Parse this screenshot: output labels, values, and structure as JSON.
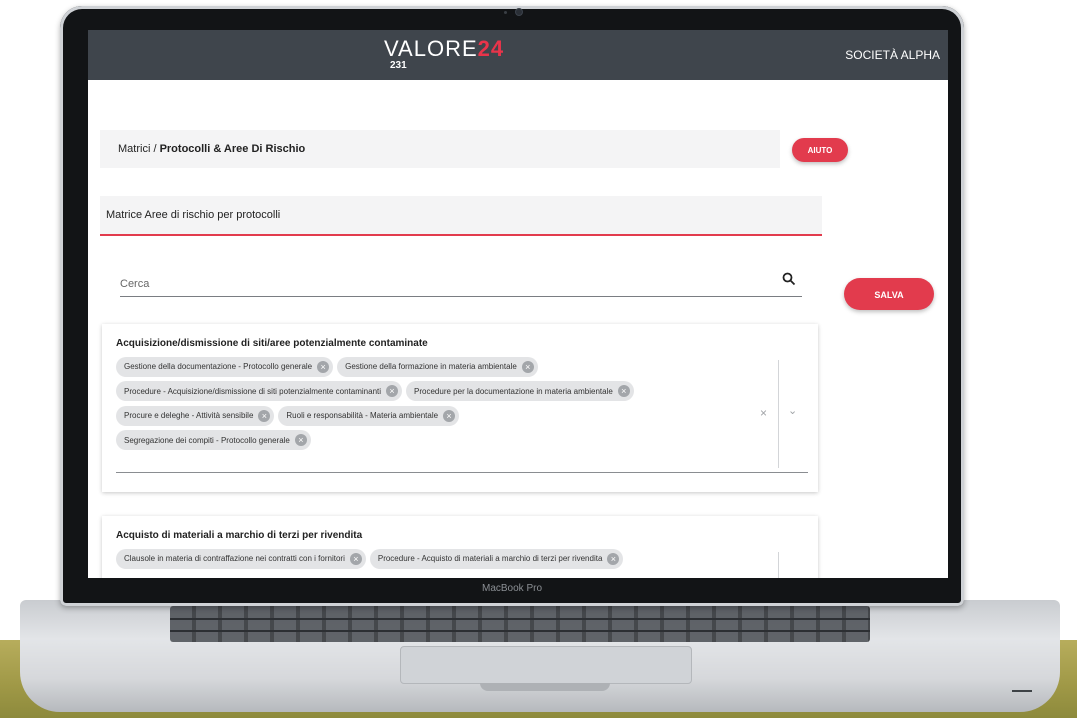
{
  "app": {
    "brand_main": "VALORE",
    "brand_accent": "24",
    "brand_sub": "231",
    "company": "SOCIETÀ ALPHA"
  },
  "breadcrumb": {
    "parent": "Matrici /",
    "current": "Protocolli & Aree Di Rischio"
  },
  "buttons": {
    "help": "AIUTO",
    "save": "SALVA"
  },
  "section": {
    "title": "Matrice Aree di rischio per protocolli"
  },
  "search": {
    "placeholder": "Cerca"
  },
  "cards": [
    {
      "title": "Acquisizione/dismissione di siti/aree potenzialmente contaminate",
      "chips": [
        "Gestione della documentazione - Protocollo generale",
        "Gestione della formazione in materia ambientale",
        "Procedure - Acquisizione/dismissione di siti potenzialmente contaminanti",
        "Procedure per la documentazione in materia ambientale",
        "Procure e deleghe - Attività sensibile",
        "Ruoli e responsabilità - Materia ambientale",
        "Segregazione dei compiti - Protocollo generale"
      ]
    },
    {
      "title": "Acquisto di materiali a marchio di terzi per rivendita",
      "chips": [
        "Clausole in materia di contraffazione nei contratti con i fornitori",
        "Procedure - Acquisto di materiali a marchio di terzi per rivendita"
      ]
    }
  ],
  "device": {
    "label": "MacBook Pro"
  },
  "colors": {
    "header": "#3f454c",
    "accent": "#e23b4d"
  }
}
